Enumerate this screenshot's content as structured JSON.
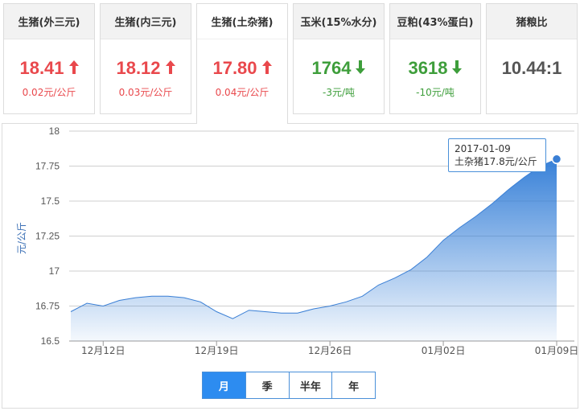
{
  "cards": [
    {
      "name": "生猪(外三元)",
      "price": "18.41",
      "change": "0.02元/公斤",
      "trend": "up"
    },
    {
      "name": "生猪(内三元)",
      "price": "18.12",
      "change": "0.03元/公斤",
      "trend": "up"
    },
    {
      "name": "生猪(土杂猪)",
      "price": "17.80",
      "change": "0.04元/公斤",
      "trend": "up"
    },
    {
      "name": "玉米(15%水分)",
      "price": "1764",
      "change": "-3元/吨",
      "trend": "down"
    },
    {
      "name": "豆粕(43%蛋白)",
      "price": "3618",
      "change": "-10元/吨",
      "trend": "down"
    },
    {
      "name": "猪粮比",
      "price": "10.44:1",
      "change": "",
      "trend": "flat"
    }
  ],
  "colors": {
    "up": "#e9484c",
    "down": "#3e9e3b",
    "accent": "#2d8cf0",
    "series": "#3a7fd5"
  },
  "icons": {
    "up": "arrow-up-icon",
    "down": "arrow-down-icon"
  },
  "tooltip": {
    "date": "2017-01-09",
    "text": "土杂猪17.8元/公斤"
  },
  "range_tabs": [
    "月",
    "季",
    "半年",
    "年"
  ],
  "active_tab": 0,
  "chart_data": {
    "type": "area",
    "ylabel": "元/公斤",
    "xlabel": "",
    "ylim": [
      16.5,
      18
    ],
    "yticks": [
      16.5,
      16.75,
      17,
      17.25,
      17.5,
      17.75,
      18
    ],
    "xtick_labels": [
      "12月12日",
      "12月19日",
      "12月26日",
      "01月02日",
      "01月09日"
    ],
    "grid": true,
    "series": [
      {
        "x": [
          "12-10",
          "12-11",
          "12-12",
          "12-13",
          "12-14",
          "12-15",
          "12-16",
          "12-17",
          "12-18",
          "12-19",
          "12-20",
          "12-21",
          "12-22",
          "12-23",
          "12-24",
          "12-25",
          "12-26",
          "12-27",
          "12-28",
          "12-29",
          "12-30",
          "12-31",
          "01-01",
          "01-02",
          "01-03",
          "01-04",
          "01-05",
          "01-06",
          "01-07",
          "01-08",
          "01-09"
        ],
        "values": [
          16.71,
          16.77,
          16.75,
          16.79,
          16.81,
          16.82,
          16.82,
          16.81,
          16.78,
          16.71,
          16.66,
          16.72,
          16.71,
          16.7,
          16.7,
          16.73,
          16.75,
          16.78,
          16.82,
          16.9,
          16.95,
          17.01,
          17.1,
          17.22,
          17.31,
          17.39,
          17.48,
          17.58,
          17.67,
          17.75,
          17.8
        ]
      }
    ]
  }
}
